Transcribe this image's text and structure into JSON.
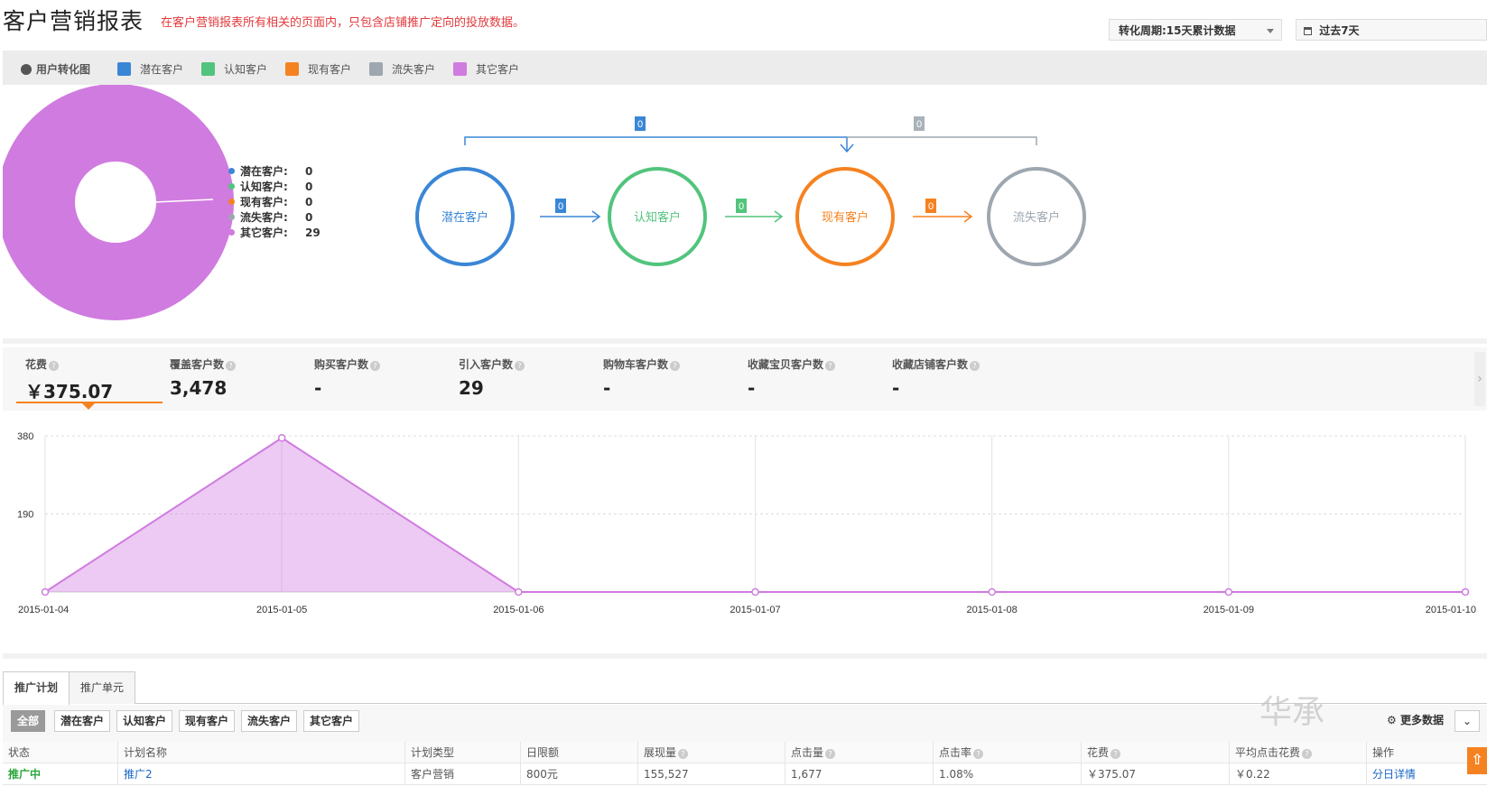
{
  "header": {
    "title": "客户营销报表",
    "subtitle": "在客户营销报表所有相关的页面内，只包含店铺推广定向的投放数据。",
    "period_label": "转化周期:15天累计数据",
    "date_label": "过去7天"
  },
  "legend": {
    "title": "用户转化图",
    "items": [
      {
        "label": "潜在客户",
        "color": "#3a86d6"
      },
      {
        "label": "认知客户",
        "color": "#52c47d"
      },
      {
        "label": "现有客户",
        "color": "#f58220"
      },
      {
        "label": "流失客户",
        "color": "#9ea7b0"
      },
      {
        "label": "其它客户",
        "color": "#d07be0"
      }
    ]
  },
  "pie": {
    "rows": [
      {
        "label": "潜在客户:",
        "value": "0",
        "color": "#3a86d6"
      },
      {
        "label": "认知客户:",
        "value": "0",
        "color": "#52c47d"
      },
      {
        "label": "现有客户:",
        "value": "0",
        "color": "#f58220"
      },
      {
        "label": "流失客户:",
        "value": "0",
        "color": "#9ea7b0"
      },
      {
        "label": "其它客户:",
        "value": "29",
        "color": "#d07be0"
      }
    ]
  },
  "flow": {
    "nodes": [
      {
        "label": "潜在客户",
        "color": "#3a86d6"
      },
      {
        "label": "认知客户",
        "color": "#52c47d"
      },
      {
        "label": "现有客户",
        "color": "#f58220"
      },
      {
        "label": "流失客户",
        "color": "#9ea7b0"
      }
    ],
    "step_badges": [
      "0",
      "0",
      "0"
    ],
    "top_badges": [
      "0",
      "0"
    ]
  },
  "metrics": [
    {
      "label": "花费",
      "value": "￥375.07"
    },
    {
      "label": "覆盖客户数",
      "value": "3,478"
    },
    {
      "label": "购买客户数",
      "value": "-"
    },
    {
      "label": "引入客户数",
      "value": "29"
    },
    {
      "label": "购物车客户数",
      "value": "-"
    },
    {
      "label": "收藏宝贝客户数",
      "value": "-"
    },
    {
      "label": "收藏店铺客户数",
      "value": "-"
    }
  ],
  "chart_data": {
    "type": "area",
    "x": [
      "2015-01-04",
      "2015-01-05",
      "2015-01-06",
      "2015-01-07",
      "2015-01-08",
      "2015-01-09",
      "2015-01-10"
    ],
    "series": [
      {
        "name": "花费",
        "values": [
          0,
          375.07,
          0,
          0,
          0,
          0,
          0
        ]
      }
    ],
    "yticks": [
      "380",
      "190"
    ],
    "ylim": [
      0,
      380
    ],
    "color": "#d07be0"
  },
  "tabs": [
    "推广计划",
    "推广单元"
  ],
  "filters": [
    "全部",
    "潜在客户",
    "认知客户",
    "现有客户",
    "流失客户",
    "其它客户"
  ],
  "more_data": "更多数据",
  "table": {
    "headers": [
      "状态",
      "计划名称",
      "计划类型",
      "日限额",
      "展现量",
      "点击量",
      "点击率",
      "花费",
      "平均点击花费",
      "操作"
    ],
    "rows": [
      [
        "推广中",
        "推广2",
        "客户营销",
        "800元",
        "155,527",
        "1,677",
        "1.08%",
        "￥375.07",
        "￥0.22",
        "分日详情"
      ]
    ]
  },
  "watermark": "华承"
}
